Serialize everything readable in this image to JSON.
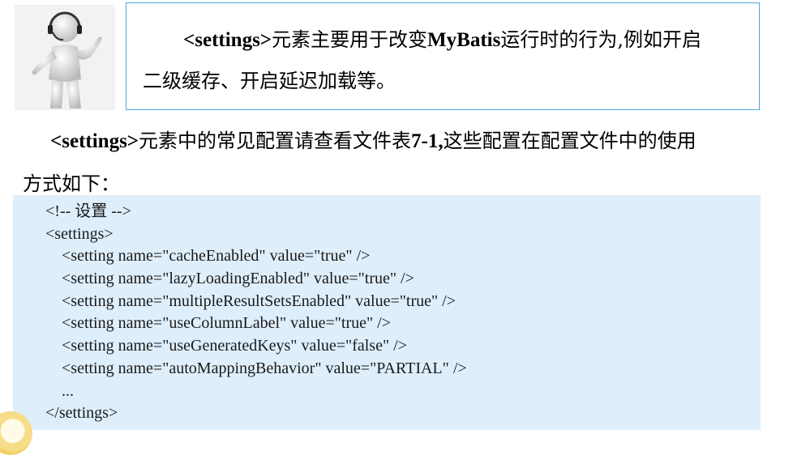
{
  "callout": {
    "kw": "<settings>",
    "text_line1_rest": "元素主要用于改变",
    "kw2": "MyBatis",
    "text_line1_tail": "运行时的行为,例如开启",
    "text_line2": "二级缓存、开启延迟加载等。"
  },
  "paragraph": {
    "kw": "<settings>",
    "rest1": "元素中的常见配置请查看文件表",
    "ref": "7-1,",
    "rest2": "这些配置在配置文件中的使用",
    "line2": "方式如下："
  },
  "code_lines": [
    "<!-- 设置 -->",
    "<settings>",
    "    <setting name=\"cacheEnabled\" value=\"true\" />",
    "    <setting name=\"lazyLoadingEnabled\" value=\"true\" />",
    "    <setting name=\"multipleResultSetsEnabled\" value=\"true\" />",
    "    <setting name=\"useColumnLabel\" value=\"true\" />",
    "    <setting name=\"useGeneratedKeys\" value=\"false\" />",
    "    <setting name=\"autoMappingBehavior\" value=\"PARTIAL\" />",
    "    ...",
    "</settings>"
  ]
}
